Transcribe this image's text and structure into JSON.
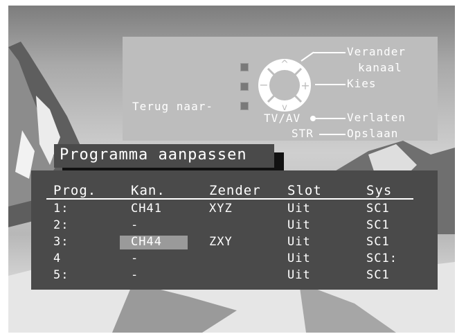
{
  "remote": {
    "back_label": "Terug naar-",
    "change_channel_line1": "Verander",
    "change_channel_line2": "kanaal",
    "select_label": "Kies",
    "exit_label": "Verlaten",
    "tvav_label": "TV/AV",
    "store_label": "Opslaan",
    "str_label": "STR"
  },
  "title": "Programma aanpassen",
  "table": {
    "headers": [
      "Prog.",
      "Kan.",
      "Zender",
      "Slot",
      "Sys"
    ],
    "rows": [
      [
        "1:",
        "CH41",
        "XYZ",
        "Uit",
        "SC1"
      ],
      [
        "2:",
        "-",
        "",
        "Uit",
        "SC1"
      ],
      [
        "3:",
        "CH44",
        "ZXY",
        "Uit",
        "SC1"
      ],
      [
        "4",
        "-",
        "",
        "Uit",
        "SC1:"
      ],
      [
        "5:",
        "-",
        "",
        "Uit",
        "SC1"
      ]
    ],
    "highlighted_row": 2
  }
}
